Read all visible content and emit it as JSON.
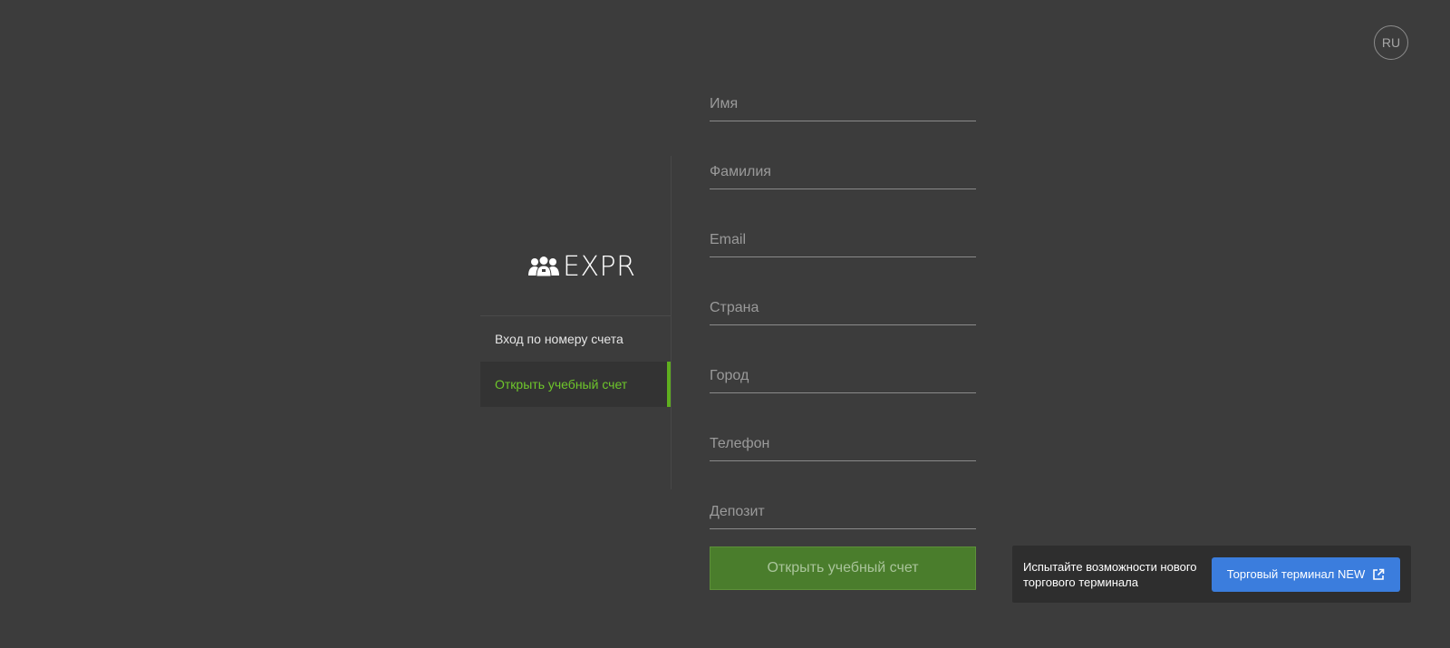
{
  "language": {
    "label": "RU"
  },
  "logo": {
    "text": "EXPR",
    "icon": "users-group-icon"
  },
  "side_nav": {
    "items": [
      {
        "label": "Вход по номеру счета",
        "active": false
      },
      {
        "label": "Открыть учебный счет",
        "active": true
      }
    ]
  },
  "form": {
    "fields": [
      {
        "placeholder": "Имя",
        "value": ""
      },
      {
        "placeholder": "Фамилия",
        "value": ""
      },
      {
        "placeholder": "Email",
        "value": ""
      },
      {
        "placeholder": "Страна",
        "value": ""
      },
      {
        "placeholder": "Город",
        "value": ""
      },
      {
        "placeholder": "Телефон",
        "value": ""
      },
      {
        "placeholder": "Депозит",
        "value": ""
      }
    ],
    "submit_label": "Открыть учебный счет"
  },
  "promo": {
    "text": "Испытайте возможности нового торгового терминала",
    "button_label": "Торговый терминал NEW",
    "button_icon": "external-link-icon"
  },
  "colors": {
    "background": "#3c3c3c",
    "accent_green": "#6ec62b",
    "submit_bg": "#4a7d2c",
    "promo_button": "#3b7ddd"
  }
}
